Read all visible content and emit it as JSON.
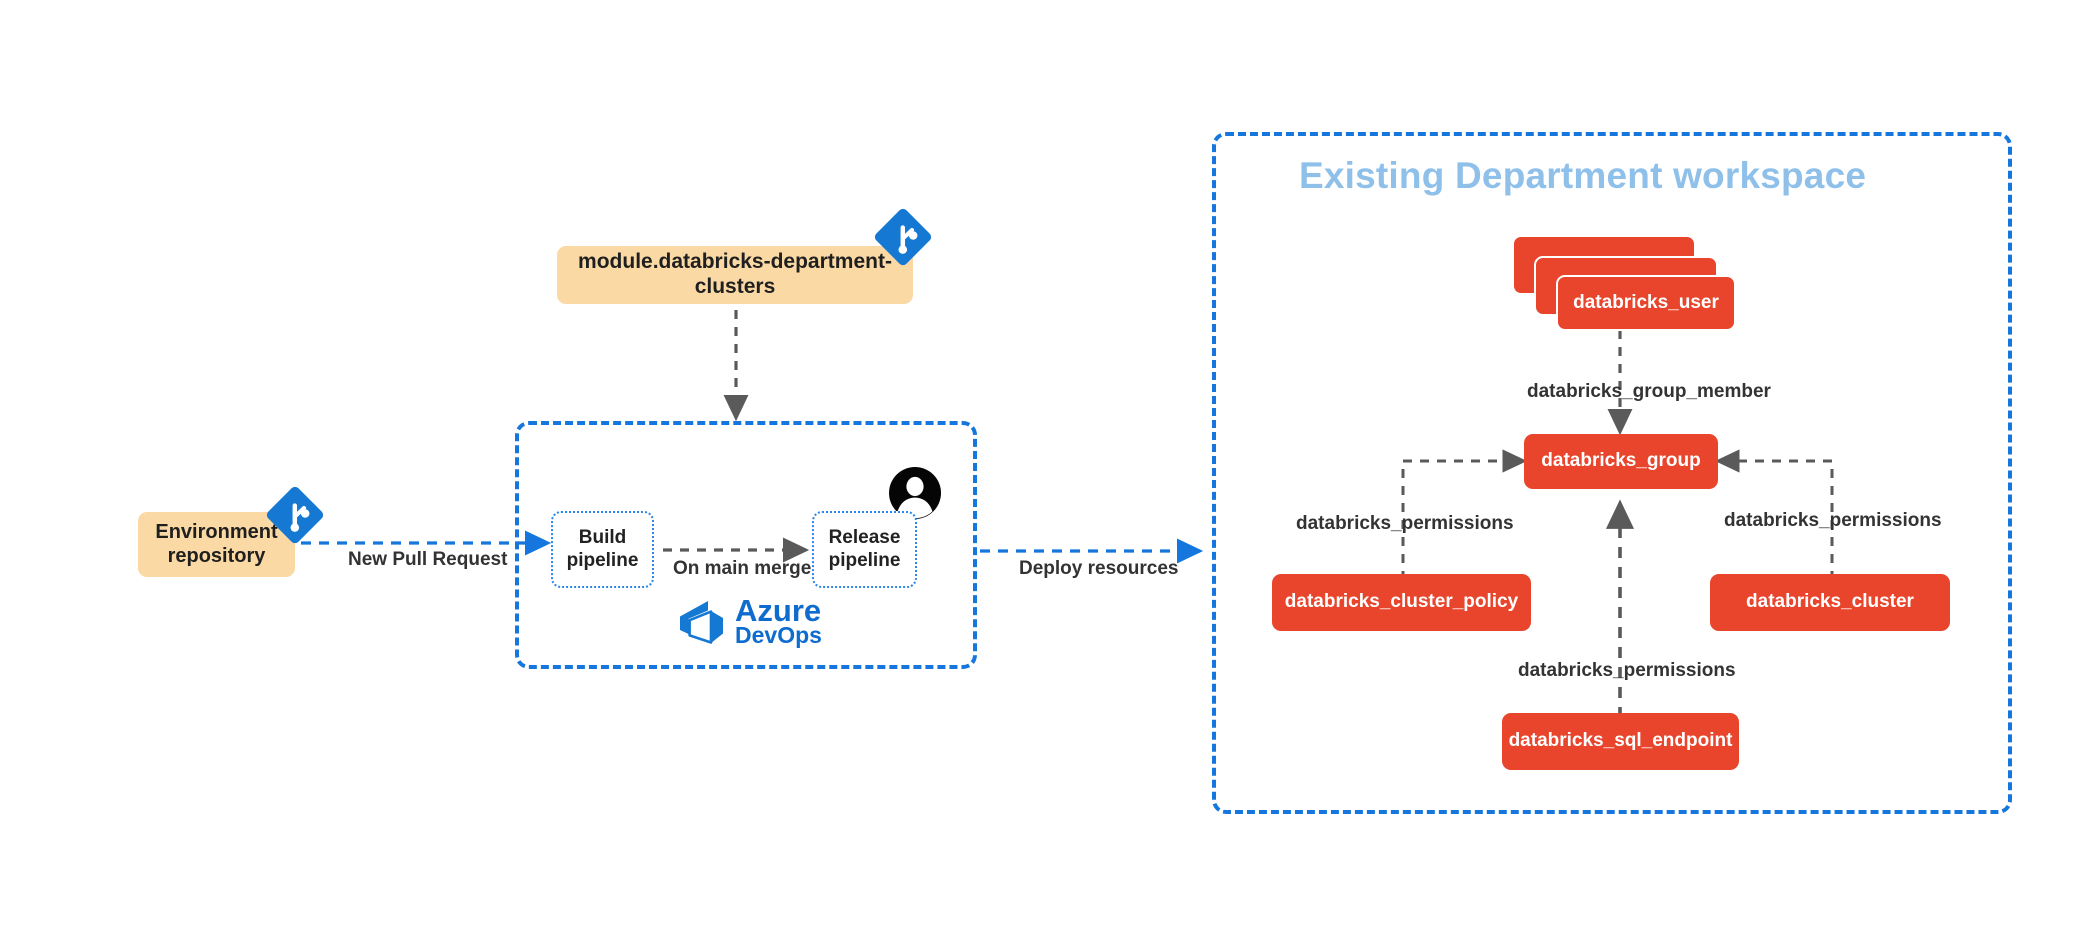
{
  "diagram": {
    "title_workspace": "Existing Department workspace",
    "colors": {
      "tan_fill": "#FBD9A5",
      "resource_fill": "#E8452C",
      "container_border": "#1577DD",
      "workspace_title": "#8EC0EA",
      "azure_blue": "#0D6CCD",
      "git_blue": "#1578D3",
      "arrow_gray": "#5A5A5A",
      "arrow_blue": "#1577DD",
      "text_dark": "#333333"
    },
    "left": {
      "env_repo_line1": "Environment",
      "env_repo_line2": "repository",
      "module_box": "module.databricks-department-clusters",
      "git_icon_repo": "git-icon",
      "git_icon_module": "git-icon"
    },
    "pipeline": {
      "build_line1": "Build",
      "build_line2": "pipeline",
      "release_line1": "Release",
      "release_line2": "pipeline",
      "azure_name_1": "Azure",
      "azure_name_2": "DevOps",
      "user_icon": "person-icon"
    },
    "edges": {
      "new_pull_request": "New Pull Request",
      "on_main_merge": "On main merge",
      "deploy_resources": "Deploy resources",
      "group_member": "databricks_group_member",
      "permissions_left": "databricks_permissions",
      "permissions_right": "databricks_permissions",
      "permissions_bottom": "databricks_permissions"
    },
    "resources": {
      "user": "databricks_user",
      "group": "databricks_group",
      "cluster_policy": "databricks_cluster_policy",
      "cluster": "databricks_cluster",
      "sql_endpoint": "databricks_sql_endpoint"
    }
  }
}
